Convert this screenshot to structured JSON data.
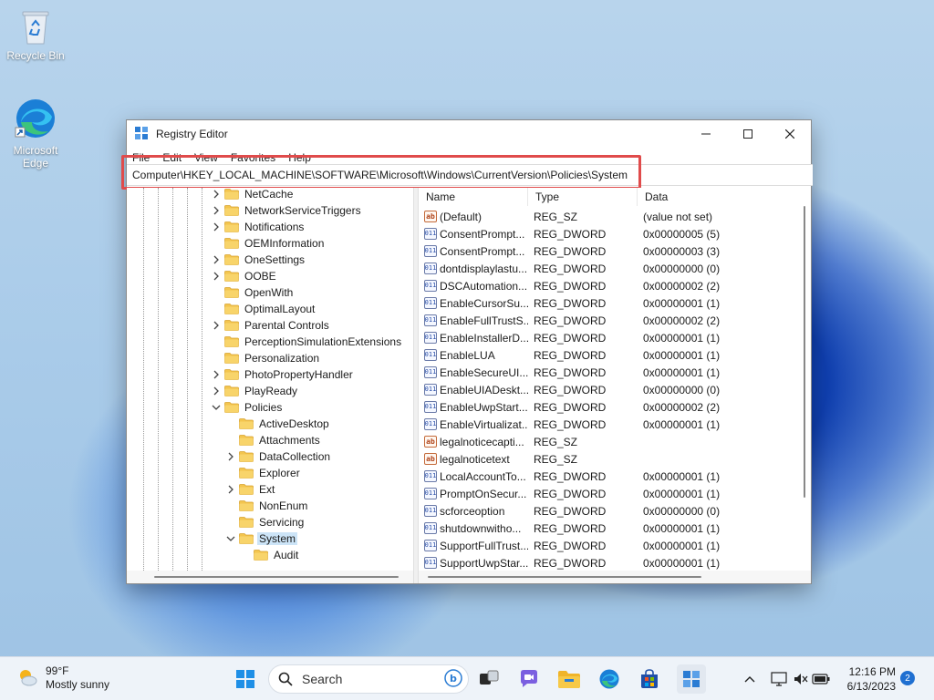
{
  "desktop": {
    "icons": [
      {
        "label": "Recycle Bin"
      },
      {
        "label": "Microsoft Edge"
      }
    ]
  },
  "window": {
    "title": "Registry Editor",
    "menu": [
      "File",
      "Edit",
      "View",
      "Favorites",
      "Help"
    ],
    "address": "Computer\\HKEY_LOCAL_MACHINE\\SOFTWARE\\Microsoft\\Windows\\CurrentVersion\\Policies\\System",
    "highlight_color": "#e04b4b"
  },
  "tree": {
    "items": [
      {
        "label": "NetCache",
        "level": 1,
        "expander": "collapsed"
      },
      {
        "label": "NetworkServiceTriggers",
        "level": 1,
        "expander": "collapsed"
      },
      {
        "label": "Notifications",
        "level": 1,
        "expander": "collapsed"
      },
      {
        "label": "OEMInformation",
        "level": 1,
        "expander": "none"
      },
      {
        "label": "OneSettings",
        "level": 1,
        "expander": "collapsed"
      },
      {
        "label": "OOBE",
        "level": 1,
        "expander": "collapsed"
      },
      {
        "label": "OpenWith",
        "level": 1,
        "expander": "none"
      },
      {
        "label": "OptimalLayout",
        "level": 1,
        "expander": "none"
      },
      {
        "label": "Parental Controls",
        "level": 1,
        "expander": "collapsed"
      },
      {
        "label": "PerceptionSimulationExtensions",
        "level": 1,
        "expander": "none"
      },
      {
        "label": "Personalization",
        "level": 1,
        "expander": "none"
      },
      {
        "label": "PhotoPropertyHandler",
        "level": 1,
        "expander": "collapsed"
      },
      {
        "label": "PlayReady",
        "level": 1,
        "expander": "collapsed"
      },
      {
        "label": "Policies",
        "level": 1,
        "expander": "expanded"
      },
      {
        "label": "ActiveDesktop",
        "level": 2,
        "expander": "none"
      },
      {
        "label": "Attachments",
        "level": 2,
        "expander": "none"
      },
      {
        "label": "DataCollection",
        "level": 2,
        "expander": "collapsed"
      },
      {
        "label": "Explorer",
        "level": 2,
        "expander": "none"
      },
      {
        "label": "Ext",
        "level": 2,
        "expander": "collapsed"
      },
      {
        "label": "NonEnum",
        "level": 2,
        "expander": "none"
      },
      {
        "label": "Servicing",
        "level": 2,
        "expander": "none"
      },
      {
        "label": "System",
        "level": 2,
        "expander": "expanded",
        "selected": true
      },
      {
        "label": "Audit",
        "level": 3,
        "expander": "none"
      }
    ]
  },
  "list": {
    "headers": {
      "name": "Name",
      "type": "Type",
      "data": "Data"
    },
    "rows": [
      {
        "icon": "string-value-icon",
        "name": "(Default)",
        "type": "REG_SZ",
        "data": "(value not set)"
      },
      {
        "icon": "dword-value-icon",
        "name": "ConsentPrompt...",
        "type": "REG_DWORD",
        "data": "0x00000005 (5)"
      },
      {
        "icon": "dword-value-icon",
        "name": "ConsentPrompt...",
        "type": "REG_DWORD",
        "data": "0x00000003 (3)"
      },
      {
        "icon": "dword-value-icon",
        "name": "dontdisplaylastu...",
        "type": "REG_DWORD",
        "data": "0x00000000 (0)"
      },
      {
        "icon": "dword-value-icon",
        "name": "DSCAutomation...",
        "type": "REG_DWORD",
        "data": "0x00000002 (2)"
      },
      {
        "icon": "dword-value-icon",
        "name": "EnableCursorSu...",
        "type": "REG_DWORD",
        "data": "0x00000001 (1)"
      },
      {
        "icon": "dword-value-icon",
        "name": "EnableFullTrustS...",
        "type": "REG_DWORD",
        "data": "0x00000002 (2)"
      },
      {
        "icon": "dword-value-icon",
        "name": "EnableInstallerD...",
        "type": "REG_DWORD",
        "data": "0x00000001 (1)"
      },
      {
        "icon": "dword-value-icon",
        "name": "EnableLUA",
        "type": "REG_DWORD",
        "data": "0x00000001 (1)"
      },
      {
        "icon": "dword-value-icon",
        "name": "EnableSecureUI...",
        "type": "REG_DWORD",
        "data": "0x00000001 (1)"
      },
      {
        "icon": "dword-value-icon",
        "name": "EnableUIADeskt...",
        "type": "REG_DWORD",
        "data": "0x00000000 (0)"
      },
      {
        "icon": "dword-value-icon",
        "name": "EnableUwpStart...",
        "type": "REG_DWORD",
        "data": "0x00000002 (2)"
      },
      {
        "icon": "dword-value-icon",
        "name": "EnableVirtualizat...",
        "type": "REG_DWORD",
        "data": "0x00000001 (1)"
      },
      {
        "icon": "string-value-icon",
        "name": "legalnoticecapti...",
        "type": "REG_SZ",
        "data": ""
      },
      {
        "icon": "string-value-icon",
        "name": "legalnoticetext",
        "type": "REG_SZ",
        "data": ""
      },
      {
        "icon": "dword-value-icon",
        "name": "LocalAccountTo...",
        "type": "REG_DWORD",
        "data": "0x00000001 (1)"
      },
      {
        "icon": "dword-value-icon",
        "name": "PromptOnSecur...",
        "type": "REG_DWORD",
        "data": "0x00000001 (1)"
      },
      {
        "icon": "dword-value-icon",
        "name": "scforceoption",
        "type": "REG_DWORD",
        "data": "0x00000000 (0)"
      },
      {
        "icon": "dword-value-icon",
        "name": "shutdownwitho...",
        "type": "REG_DWORD",
        "data": "0x00000001 (1)"
      },
      {
        "icon": "dword-value-icon",
        "name": "SupportFullTrust...",
        "type": "REG_DWORD",
        "data": "0x00000001 (1)"
      },
      {
        "icon": "dword-value-icon",
        "name": "SupportUwpStar...",
        "type": "REG_DWORD",
        "data": "0x00000001 (1)"
      }
    ]
  },
  "taskbar": {
    "weather": {
      "temp": "99°F",
      "desc": "Mostly sunny"
    },
    "search_placeholder": "Search",
    "apps": [
      "start-icon",
      "search-highlight-icon",
      "task-view-icon",
      "chat-icon",
      "file-explorer-icon",
      "edge-icon",
      "store-icon",
      "registry-editor-icon"
    ],
    "clock": {
      "time": "12:16 PM",
      "date": "6/13/2023"
    },
    "notification_count": "2"
  }
}
